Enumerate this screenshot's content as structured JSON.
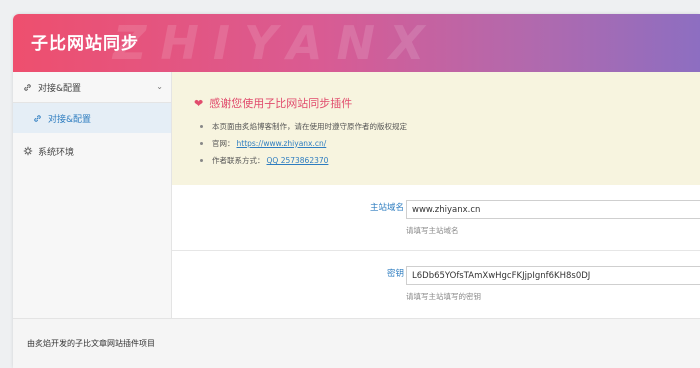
{
  "header": {
    "title": "子比网站同步",
    "watermark": "ZHIYANX"
  },
  "sidebar": {
    "items": [
      {
        "label": "对接&配置",
        "icon": "link-icon"
      },
      {
        "label": "对接&配置",
        "icon": "link-icon"
      },
      {
        "label": "系统环境",
        "icon": "gear-icon"
      }
    ]
  },
  "notice": {
    "title": "感谢您使用子比网站同步插件",
    "line1": "本页面由炙焰博客制作，请在使用时遵守原作者的版权规定",
    "line2_label": "官网：",
    "line2_link": "https://www.zhiyanx.cn/",
    "line3_label": "作者联系方式：",
    "line3_link": "QQ 2573862370"
  },
  "fields": {
    "domain": {
      "label": "主站域名",
      "value": "www.zhiyanx.cn",
      "help": "请填写主站域名"
    },
    "key": {
      "label": "密钥",
      "value": "L6Db65YOfsTAmXwHgcFKJjpIgnf6KH8s0DJ",
      "help": "请填写主站填写的密钥"
    }
  },
  "footer": {
    "text": "由炙焰开发的子比文章网站插件项目"
  },
  "colors": {
    "accent": "#2e7dc0",
    "heart": "#e14c6d"
  }
}
